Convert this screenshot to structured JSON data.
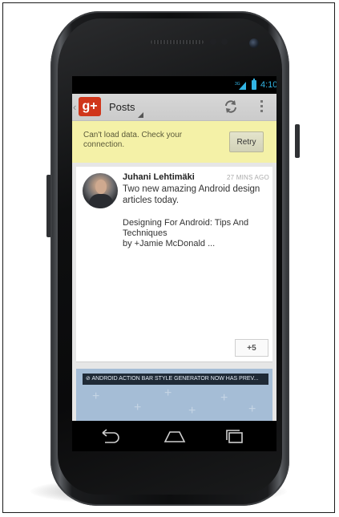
{
  "statusbar": {
    "network": "3G",
    "time": "4:10"
  },
  "actionbar": {
    "title": "Posts",
    "back_icon": "chevron-left-icon",
    "logo_icon": "google-plus-icon",
    "refresh_icon": "refresh-icon",
    "overflow_icon": "overflow-menu-icon"
  },
  "error": {
    "message": "Can't load data. Check your connection.",
    "retry_label": "Retry"
  },
  "post": {
    "author": "Juhani Lehtimäki",
    "time_ago": "27 MINS AGO",
    "text": "Two new amazing Android design articles today.",
    "link_title_line1": "Designing For Android: Tips And",
    "link_title_line2": "Techniques",
    "link_by": "by +Jamie McDonald ...",
    "plus_count": "+5"
  },
  "post2": {
    "banner": "ANDROID ACTION BAR STYLE GENERATOR NOW HAS PREV..."
  },
  "navigation": {
    "back_icon": "back-icon",
    "home_icon": "home-icon",
    "recents_icon": "recent-apps-icon"
  },
  "colors": {
    "accent": "#33b5e5",
    "gplus_red": "#d0361b",
    "error_bg": "#f4f1a7"
  }
}
